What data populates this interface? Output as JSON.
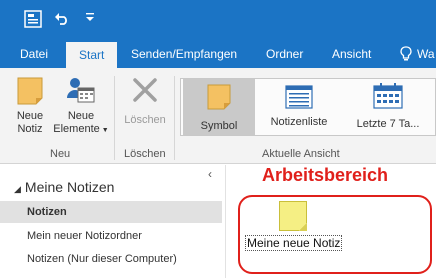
{
  "tabs": [
    {
      "label": "Datei",
      "active": false
    },
    {
      "label": "Start",
      "active": true
    },
    {
      "label": "Senden/Empfangen",
      "active": false
    },
    {
      "label": "Ordner",
      "active": false
    },
    {
      "label": "Ansicht",
      "active": false
    },
    {
      "label": "Wa",
      "active": false
    }
  ],
  "ribbon": {
    "neu_group": {
      "label": "Neu",
      "neue_notiz": [
        "Neue",
        "Notiz"
      ],
      "neue_elemente": [
        "Neue",
        "Elemente"
      ]
    },
    "loeschen_group": {
      "label": "Löschen",
      "loeschen_button": "Löschen"
    },
    "ansicht_group": {
      "label": "Aktuelle Ansicht",
      "items": [
        "Symbol",
        "Notizenliste",
        "Letzte 7 Ta..."
      ],
      "selected_index": 0
    }
  },
  "nav": {
    "header": "Meine Notizen",
    "items": [
      {
        "label": "Notizen",
        "selected": true
      },
      {
        "label": "Mein neuer Notizordner",
        "selected": false
      },
      {
        "label": "Notizen (Nur dieser Computer)",
        "selected": false
      }
    ]
  },
  "main": {
    "annotation": "Arbeitsbereich",
    "note_label": "Meine neue Notiz"
  },
  "colors": {
    "accent": "#1b74c5",
    "annotation_red": "#e0201b",
    "note_yellow": "#f5ef84"
  }
}
